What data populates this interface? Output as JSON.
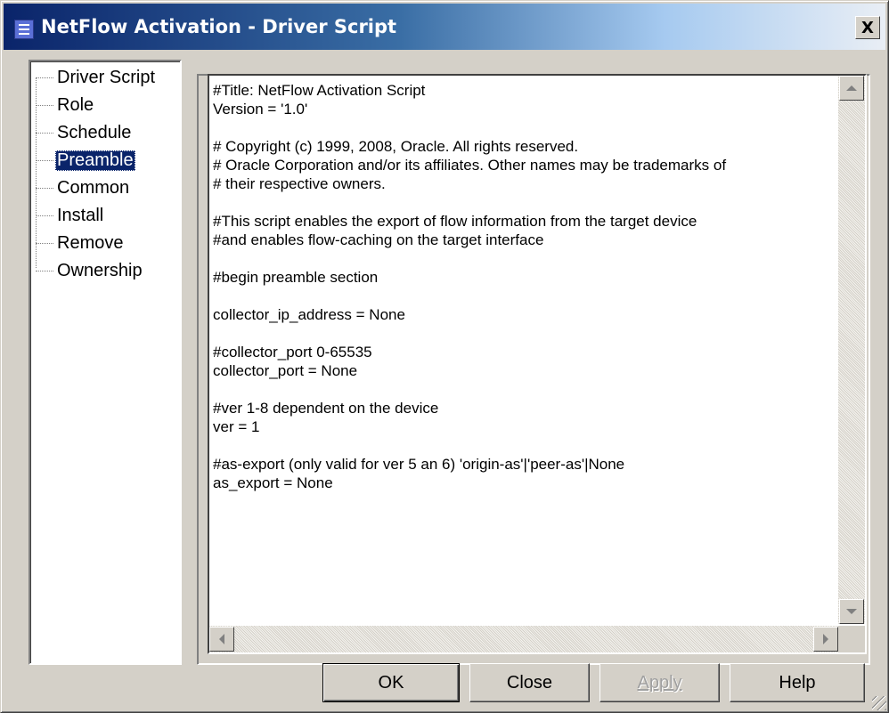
{
  "window": {
    "title": "NetFlow Activation - Driver Script",
    "close_glyph": "X"
  },
  "tree": {
    "items": [
      {
        "label": "Driver Script",
        "selected": false
      },
      {
        "label": "Role",
        "selected": false
      },
      {
        "label": "Schedule",
        "selected": false
      },
      {
        "label": "Preamble",
        "selected": true
      },
      {
        "label": "Common",
        "selected": false
      },
      {
        "label": "Install",
        "selected": false
      },
      {
        "label": "Remove",
        "selected": false
      },
      {
        "label": "Ownership",
        "selected": false
      }
    ]
  },
  "script": {
    "lines": [
      "#Title: NetFlow Activation Script",
      "Version = '1.0'",
      "",
      "# Copyright (c) 1999, 2008, Oracle. All rights reserved.",
      "# Oracle Corporation and/or its affiliates. Other names may be trademarks of",
      "# their respective owners.",
      "",
      "#This script enables the export of flow information from the target device",
      "#and enables flow-caching on the target interface",
      "",
      "#begin preamble section",
      "",
      "collector_ip_address = None",
      "",
      "#collector_port 0-65535",
      "collector_port = None",
      "",
      "#ver 1-8 dependent on the device",
      "ver = 1",
      "",
      "#as-export (only valid for ver 5 an 6) 'origin-as'|'peer-as'|None",
      "as_export = None"
    ]
  },
  "buttons": {
    "ok": "OK",
    "close": "Close",
    "apply": "Apply",
    "help": "Help"
  }
}
